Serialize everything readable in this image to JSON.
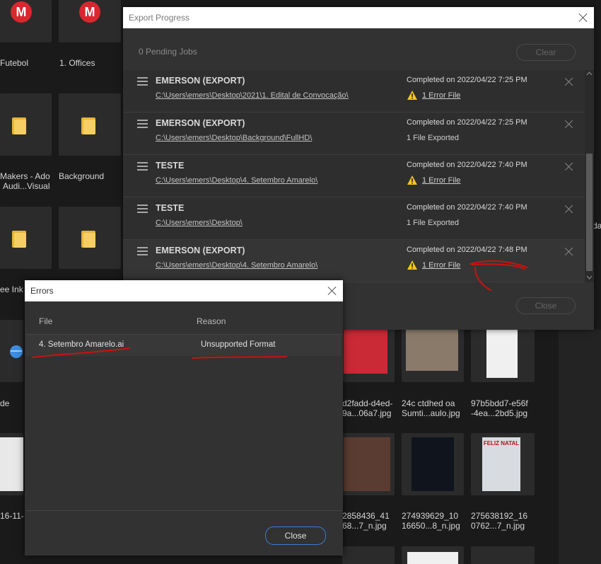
{
  "background": {
    "labels": {
      "futebol": "Futebol",
      "offices": "1. Offices",
      "makers1": "Makers - Ado",
      "makers2": "Audi...Visual",
      "background": "Background",
      "eeink": "ee Ink",
      "de": "de",
      "d2fadd1": "d2fadd-d4ed-",
      "d2fadd2": "9a...06a7.jpg",
      "c24_1": "24c ctdhed oa",
      "c24_2": "Sumti...aulo.jpg",
      "b97_1": "97b5bdd7-e56f",
      "b97_2": "-4ea...2bd5.jpg",
      "n16": "16-11-",
      "n28_1": "2858436_41",
      "n28_2": "68...7_n.jpg",
      "n27_1": "274939629_10",
      "n27_2": "16650...8_n.jpg",
      "n275_1": "275638192_16",
      "n275_2": "0762...7_n.jpg",
      "side_da": "da"
    },
    "mega_letter": "M",
    "feliz": "FELIZ NATAL",
    "colors": {
      "mega": "#d9272e",
      "folder": "#f6cf62",
      "bg": "#1a1a1a"
    }
  },
  "export": {
    "title": "Export Progress",
    "pending": "0 Pending Jobs",
    "clear_label": "Clear",
    "close_label": "Close",
    "jobs": [
      {
        "name": "EMERSON (EXPORT)",
        "path": "C:\\Users\\emers\\Desktop\\2021\\1. Edital de Convocação\\",
        "status": "Completed on 2022/04/22 7:25 PM",
        "result": "1 Error File"
      },
      {
        "name": "EMERSON (EXPORT)",
        "path": "C:\\Users\\emers\\Desktop\\Background\\FullHD\\",
        "status": "Completed on 2022/04/22 7:25 PM",
        "result": "1 File Exported"
      },
      {
        "name": "TESTE",
        "path": "C:\\Users\\emers\\Desktop\\4. Setembro Amarelo\\",
        "status": "Completed on 2022/04/22 7:40 PM",
        "result": "1 Error File"
      },
      {
        "name": "TESTE",
        "path": "C:\\Users\\emers\\Desktop\\",
        "status": "Completed on 2022/04/22 7:40 PM",
        "result": "1 File Exported"
      },
      {
        "name": "EMERSON (EXPORT)",
        "path": "C:\\Users\\emers\\Desktop\\4. Setembro Amarelo\\",
        "status": "Completed on 2022/04/22 7:48 PM",
        "result": "1 Error File"
      }
    ]
  },
  "errors": {
    "title": "Errors",
    "col_file": "File",
    "col_reason": "Reason",
    "row": {
      "file": "4. Setembro Amarelo.ai",
      "reason": "Unsupported Format"
    },
    "close_label": "Close",
    "accent": "#3d7ad6"
  },
  "annotations": {
    "color": "#cc1111"
  }
}
